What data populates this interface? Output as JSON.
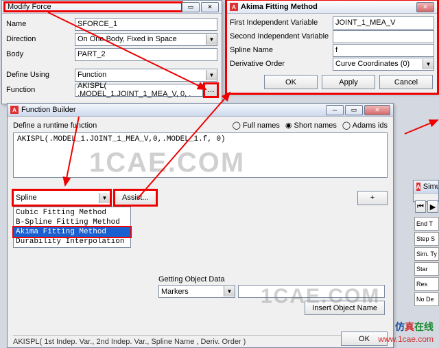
{
  "modify": {
    "title": "Modify Force",
    "labels": {
      "name": "Name",
      "direction": "Direction",
      "body": "Body",
      "define": "Define Using",
      "function": "Function"
    },
    "values": {
      "name": "SFORCE_1",
      "direction": "On One Body, Fixed in Space",
      "body": "PART_2",
      "define": "Function",
      "function": "AKISPL( .MODEL_1.JOINT_1_MEA_V, 0, ."
    }
  },
  "akima": {
    "title": "Akima Fitting Method",
    "labels": {
      "v1": "First Independent Variable",
      "v2": "Second Independent Variable",
      "spline": "Spline Name",
      "deriv": "Derivative Order"
    },
    "values": {
      "v1": "JOINT_1_MEA_V",
      "v2": "",
      "spline": "f",
      "deriv": "Curve Coordinates (0)"
    },
    "buttons": {
      "ok": "OK",
      "apply": "Apply",
      "cancel": "Cancel"
    }
  },
  "builder": {
    "title": "Function Builder",
    "define_label": "Define a runtime function",
    "radios": {
      "full": "Full names",
      "short": "Short names",
      "adams": "Adams ids"
    },
    "expr": "AKISPL(.MODEL_1.JOINT_1_MEA_V,0,.MODEL_1.f, 0)",
    "category": "Spline",
    "assist": "Assist...",
    "plus": "+",
    "methods": [
      "Cubic Fitting Method",
      "B-Spline Fitting Method",
      "Akima Fitting Method",
      "Durability Interpolation"
    ],
    "getting": "Getting Object Data",
    "markers": "Markers",
    "insert": "Insert Object Name",
    "hint": "AKISPL( 1st Indep. Var., 2nd Indep. Var., Spline Name , Deriv. Order )",
    "ok": "OK"
  },
  "side": {
    "simu": "Simu",
    "items": [
      "End T",
      "Step S",
      "Sim. Ty",
      "Star",
      "Res",
      "No De"
    ]
  },
  "watermark": "1CAE.COM",
  "footer": {
    "l1a": "仿",
    "l1b": "真",
    "l1c": "在线",
    "l2": "www.1cae.com"
  }
}
